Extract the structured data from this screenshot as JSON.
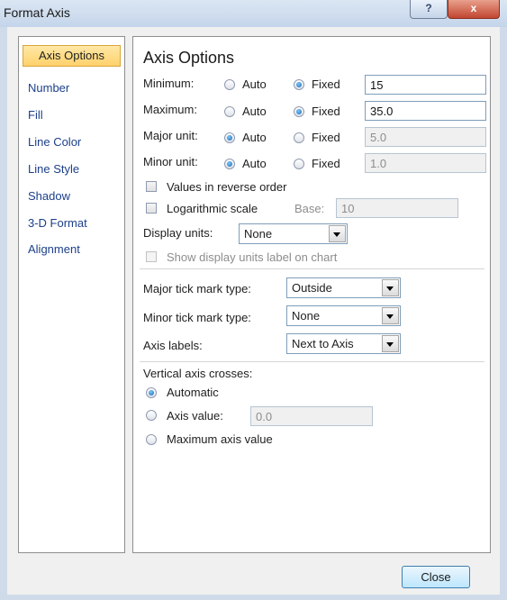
{
  "window": {
    "title": "Format Axis",
    "help_glyph": "?",
    "close_glyph": "x"
  },
  "sidebar": {
    "items": [
      {
        "label": "Axis Options",
        "selected": true
      },
      {
        "label": "Number"
      },
      {
        "label": "Fill"
      },
      {
        "label": "Line Color"
      },
      {
        "label": "Line Style"
      },
      {
        "label": "Shadow"
      },
      {
        "label": "3-D Format"
      },
      {
        "label": "Alignment"
      }
    ]
  },
  "axis_options": {
    "heading": "Axis Options",
    "auto_label": "Auto",
    "fixed_label": "Fixed",
    "minimum": {
      "label": "Minimum:",
      "mode": "Fixed",
      "value": "15"
    },
    "maximum": {
      "label": "Maximum:",
      "mode": "Fixed",
      "value": "35.0"
    },
    "major_unit": {
      "label": "Major unit:",
      "mode": "Auto",
      "value": "5.0"
    },
    "minor_unit": {
      "label": "Minor unit:",
      "mode": "Auto",
      "value": "1.0"
    },
    "reverse_order": {
      "label": "Values in reverse order",
      "checked": false
    },
    "log_scale": {
      "label": "Logarithmic scale",
      "checked": false,
      "base_label": "Base:",
      "base_value": "10"
    },
    "display_units": {
      "label": "Display units:",
      "value": "None"
    },
    "show_units_label": {
      "label": "Show display units label on chart",
      "checked": false,
      "disabled": true
    },
    "major_tick": {
      "label": "Major tick mark type:",
      "value": "Outside"
    },
    "minor_tick": {
      "label": "Minor tick mark type:",
      "value": "None"
    },
    "axis_labels": {
      "label": "Axis labels:",
      "value": "Next to Axis"
    },
    "crosses": {
      "label": "Vertical axis crosses:",
      "selected": "Automatic",
      "options": [
        "Automatic",
        "Axis value:",
        "Maximum axis value"
      ],
      "axis_value": "0.0"
    }
  },
  "footer": {
    "close_label": "Close"
  },
  "colors": {
    "title_bar": "#cfdbe9",
    "selected_item": "#ffd16b",
    "link_text": "#1c3f8a",
    "radio_on": "#1766b8"
  }
}
